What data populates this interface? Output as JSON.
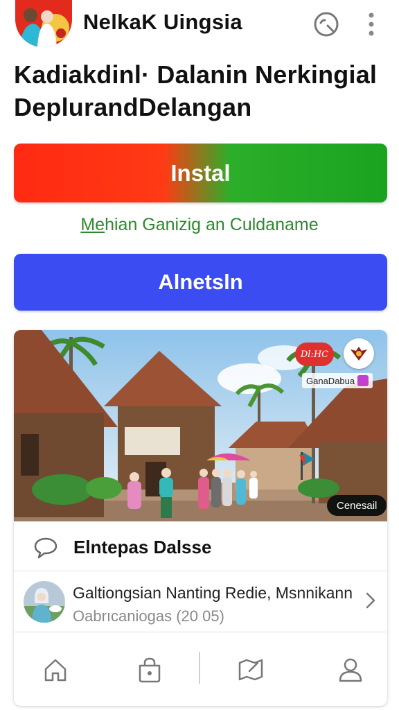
{
  "header": {
    "app_title": "NelkaK Uingsia",
    "icons": [
      "app-logo",
      "search-icon",
      "more-vert-icon"
    ]
  },
  "headline": {
    "line1": "Kadiakdinl· Dalanin Nerkingial",
    "line2": "DeplurandDelangan"
  },
  "install_button": {
    "label": "Instal"
  },
  "secondary_link": {
    "prefix": "Me",
    "rest": "hian Ganizig an Culdaname"
  },
  "alt_button": {
    "label": "Alnetsln"
  },
  "card": {
    "photo": {
      "bubble_text": "Dl:HC",
      "tag_text": "GanaDabua",
      "chip_text": "Cenesail"
    },
    "comments_row": {
      "title": "Elntepas Dalsse"
    },
    "item_row": {
      "title": "Galtiongsian Nanting Redie, Msnnikann",
      "subtitle": "Oabrıcaniogas (20 05)"
    }
  },
  "bottom_nav": {
    "items": [
      "home-icon",
      "lock-bag-icon",
      "map-flag-icon",
      "profile-icon"
    ]
  },
  "colors": {
    "install_red": "#ff2a12",
    "install_green": "#1aa31f",
    "link_green": "#2b8a2b",
    "alt_blue": "#3b4df2"
  }
}
